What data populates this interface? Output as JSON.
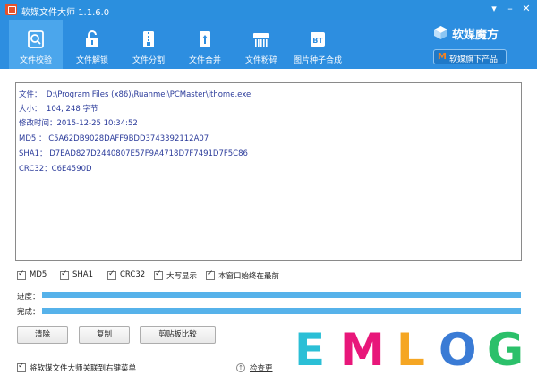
{
  "window": {
    "title": "软媒文件大师 1.1.6.0",
    "controls": [
      "▾",
      "–",
      "✕"
    ]
  },
  "toolbar": {
    "items": [
      {
        "label": "文件校验",
        "icon": "search-file-icon",
        "active": true
      },
      {
        "label": "文件解锁",
        "icon": "unlock-icon",
        "active": false
      },
      {
        "label": "文件分割",
        "icon": "zip-split-icon",
        "active": false
      },
      {
        "label": "文件合并",
        "icon": "merge-icon",
        "active": false
      },
      {
        "label": "文件粉碎",
        "icon": "shredder-icon",
        "active": false
      },
      {
        "label": "图片种子合成",
        "icon": "bt-icon",
        "active": false
      }
    ]
  },
  "brand": {
    "name": "软媒魔方",
    "products_label": "软媒旗下产品",
    "products_letter": "M"
  },
  "info": {
    "file_label": "文件：",
    "file_value": "D:\\Program Files (x86)\\Ruanmei\\PCMaster\\ithome.exe",
    "size_label": "大小：",
    "size_value": "104, 248 字节",
    "mtime_label": "修改时间：",
    "mtime_value": "2015-12-25 10:34:52",
    "md5_label": "MD5 ：",
    "md5_value": "C5A62DB9028DAFF9BDD3743392112A07",
    "sha1_label": "SHA1：",
    "sha1_value": "D7EAD827D2440807E57F9A4718D7F7491D7F5C86",
    "crc32_label": "CRC32：",
    "crc32_value": "C6E4590D"
  },
  "options": [
    {
      "label": "MD5",
      "checked": true
    },
    {
      "label": "SHA1",
      "checked": true
    },
    {
      "label": "CRC32",
      "checked": true
    },
    {
      "label": "大写显示",
      "checked": true
    },
    {
      "label": "本窗口始终在最前",
      "checked": true
    }
  ],
  "progress": {
    "label": "进度：",
    "fraction": 1.0
  },
  "complete": {
    "label": "完成：",
    "fraction": 1.0
  },
  "buttons": {
    "clear": "清除",
    "copy": "复制",
    "compare": "剪贴板比较"
  },
  "footer": {
    "assoc_label": "将软媒文件大师关联到右键菜单",
    "assoc_checked": true,
    "update_label": "检查更"
  },
  "watermark": {
    "text": "EMLOG",
    "letters": [
      {
        "ch": "E",
        "color": "#2bbfd6"
      },
      {
        "ch": "M",
        "color": "#e8177a"
      },
      {
        "ch": "L",
        "color": "#f5a623"
      },
      {
        "ch": "O",
        "color": "#3a7bd5"
      },
      {
        "ch": "G",
        "color": "#2bc06a"
      }
    ]
  },
  "colors": {
    "titlebar": "#2b8fde",
    "toolbar": "#2d8ee0",
    "active_tab": "#4ba6ec",
    "progress": "#56b2ea",
    "info_text": "#2a3a9a"
  }
}
